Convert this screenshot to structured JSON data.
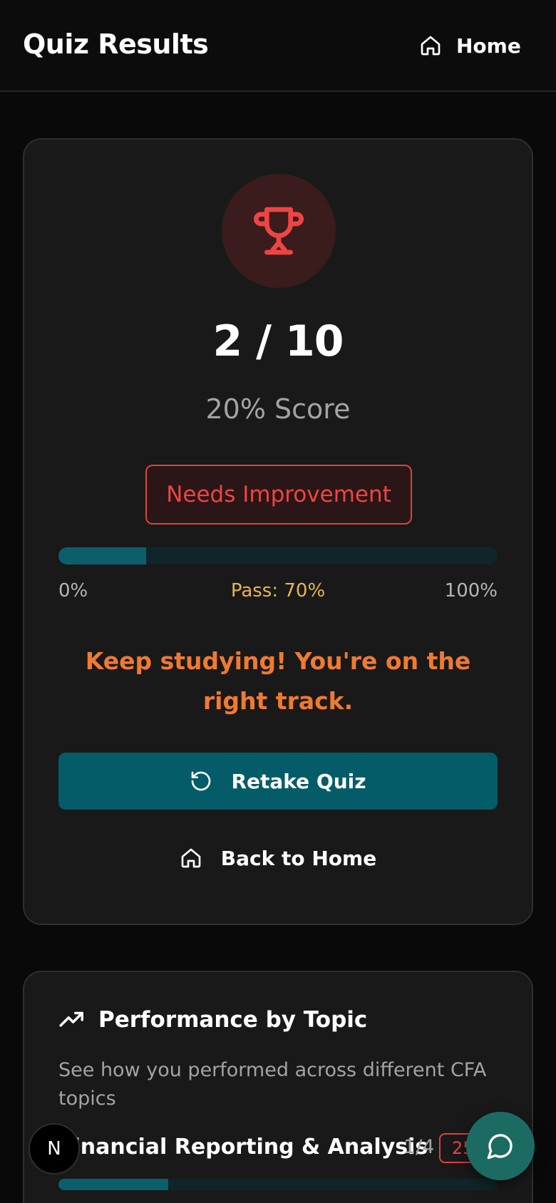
{
  "header": {
    "title": "Quiz Results",
    "home_label": "Home"
  },
  "result": {
    "icon": "trophy-icon",
    "score_fraction": "2 / 10",
    "score_percent_text": "20% Score",
    "status_badge": "Needs Improvement",
    "progress": {
      "value_percent": 20,
      "min_label": "0%",
      "pass_label": "Pass: 70%",
      "max_label": "100%"
    },
    "message": "Keep studying! You're on the right track.",
    "retake_label": "Retake Quiz",
    "back_label": "Back to Home"
  },
  "topics": {
    "icon": "trending-up-icon",
    "title": "Performance by Topic",
    "subtitle": "See how you performed across different CFA topics",
    "items": [
      {
        "name": "Financial Reporting & Analysis",
        "count": "1/4",
        "percent_label": "25%",
        "value_percent": 25
      }
    ]
  },
  "floating": {
    "avatar_letter": "N",
    "chat_icon": "chat-bubble-icon"
  },
  "colors": {
    "accent_teal": "#045c68",
    "danger": "#ef4444",
    "warning_orange": "#f07a30",
    "pass_gold": "#e8b64a"
  }
}
